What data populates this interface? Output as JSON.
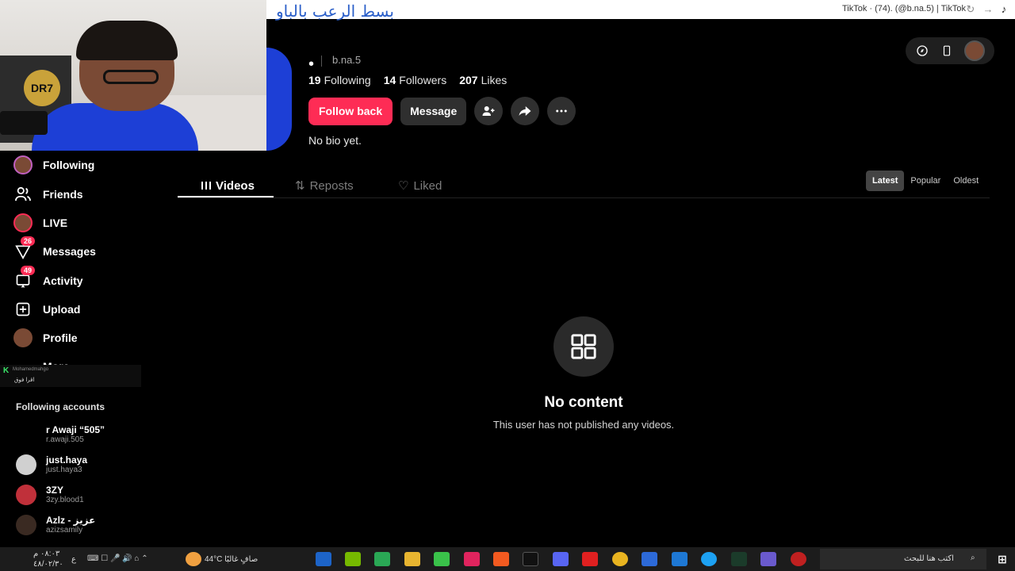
{
  "browser": {
    "tab_title": "TikTok · (74). (@b.na.5) | TikTok"
  },
  "banner": {
    "arabic_text": "بسط الرعب بالباو"
  },
  "profile": {
    "dot": "•",
    "handle": "b.na.5",
    "following_count": "19",
    "following_label": "Following",
    "followers_count": "14",
    "followers_label": "Followers",
    "likes_count": "207",
    "likes_label": "Likes",
    "follow_back_label": "Follow back",
    "message_label": "Message",
    "bio": "No bio yet."
  },
  "tabs": [
    {
      "label": "Videos",
      "active": true
    },
    {
      "label": "Reposts",
      "active": false
    },
    {
      "label": "Liked",
      "active": false
    }
  ],
  "sort_options": [
    {
      "label": "Latest",
      "active": true
    },
    {
      "label": "Popular",
      "active": false
    },
    {
      "label": "Oldest",
      "active": false
    }
  ],
  "empty_state": {
    "title": "No content",
    "subtitle": "This user has not published any videos."
  },
  "sidebar": {
    "items": [
      {
        "label": "Following",
        "icon": "following-avatar-icon"
      },
      {
        "label": "Friends",
        "icon": "friends-icon"
      },
      {
        "label": "LIVE",
        "icon": "live-avatar-icon"
      },
      {
        "label": "Messages",
        "icon": "messages-icon",
        "badge": "26"
      },
      {
        "label": "Activity",
        "icon": "activity-icon",
        "badge": "49"
      },
      {
        "label": "Upload",
        "icon": "upload-icon"
      },
      {
        "label": "Profile",
        "icon": "profile-avatar-icon"
      },
      {
        "label": "More",
        "icon": "more-icon"
      }
    ],
    "following_accounts_title": "Following accounts",
    "accounts": [
      {
        "name": "r Awaji “505”",
        "handle": "r.awaji.505"
      },
      {
        "name": "just.haya",
        "handle": "just.haya3"
      },
      {
        "name": "3ZY",
        "handle": "3zy.blood1"
      },
      {
        "name": "Azlz - عزيز",
        "handle": "azizsamily"
      }
    ]
  },
  "chat_overlay": {
    "k": "K",
    "name": "Mohamedmahgo",
    "text": "اقرا فوق"
  },
  "taskbar": {
    "weather": "44°C صافٍ غالبًا",
    "time": "٠٨:٠٣ م",
    "date": "٤٨/٠٢/٣٠",
    "lang": "ع",
    "search_placeholder": "اكتب هنا للبحث"
  },
  "colors": {
    "accent": "#fe2c55",
    "background": "#000000",
    "button_dark": "#2f2f2f"
  }
}
